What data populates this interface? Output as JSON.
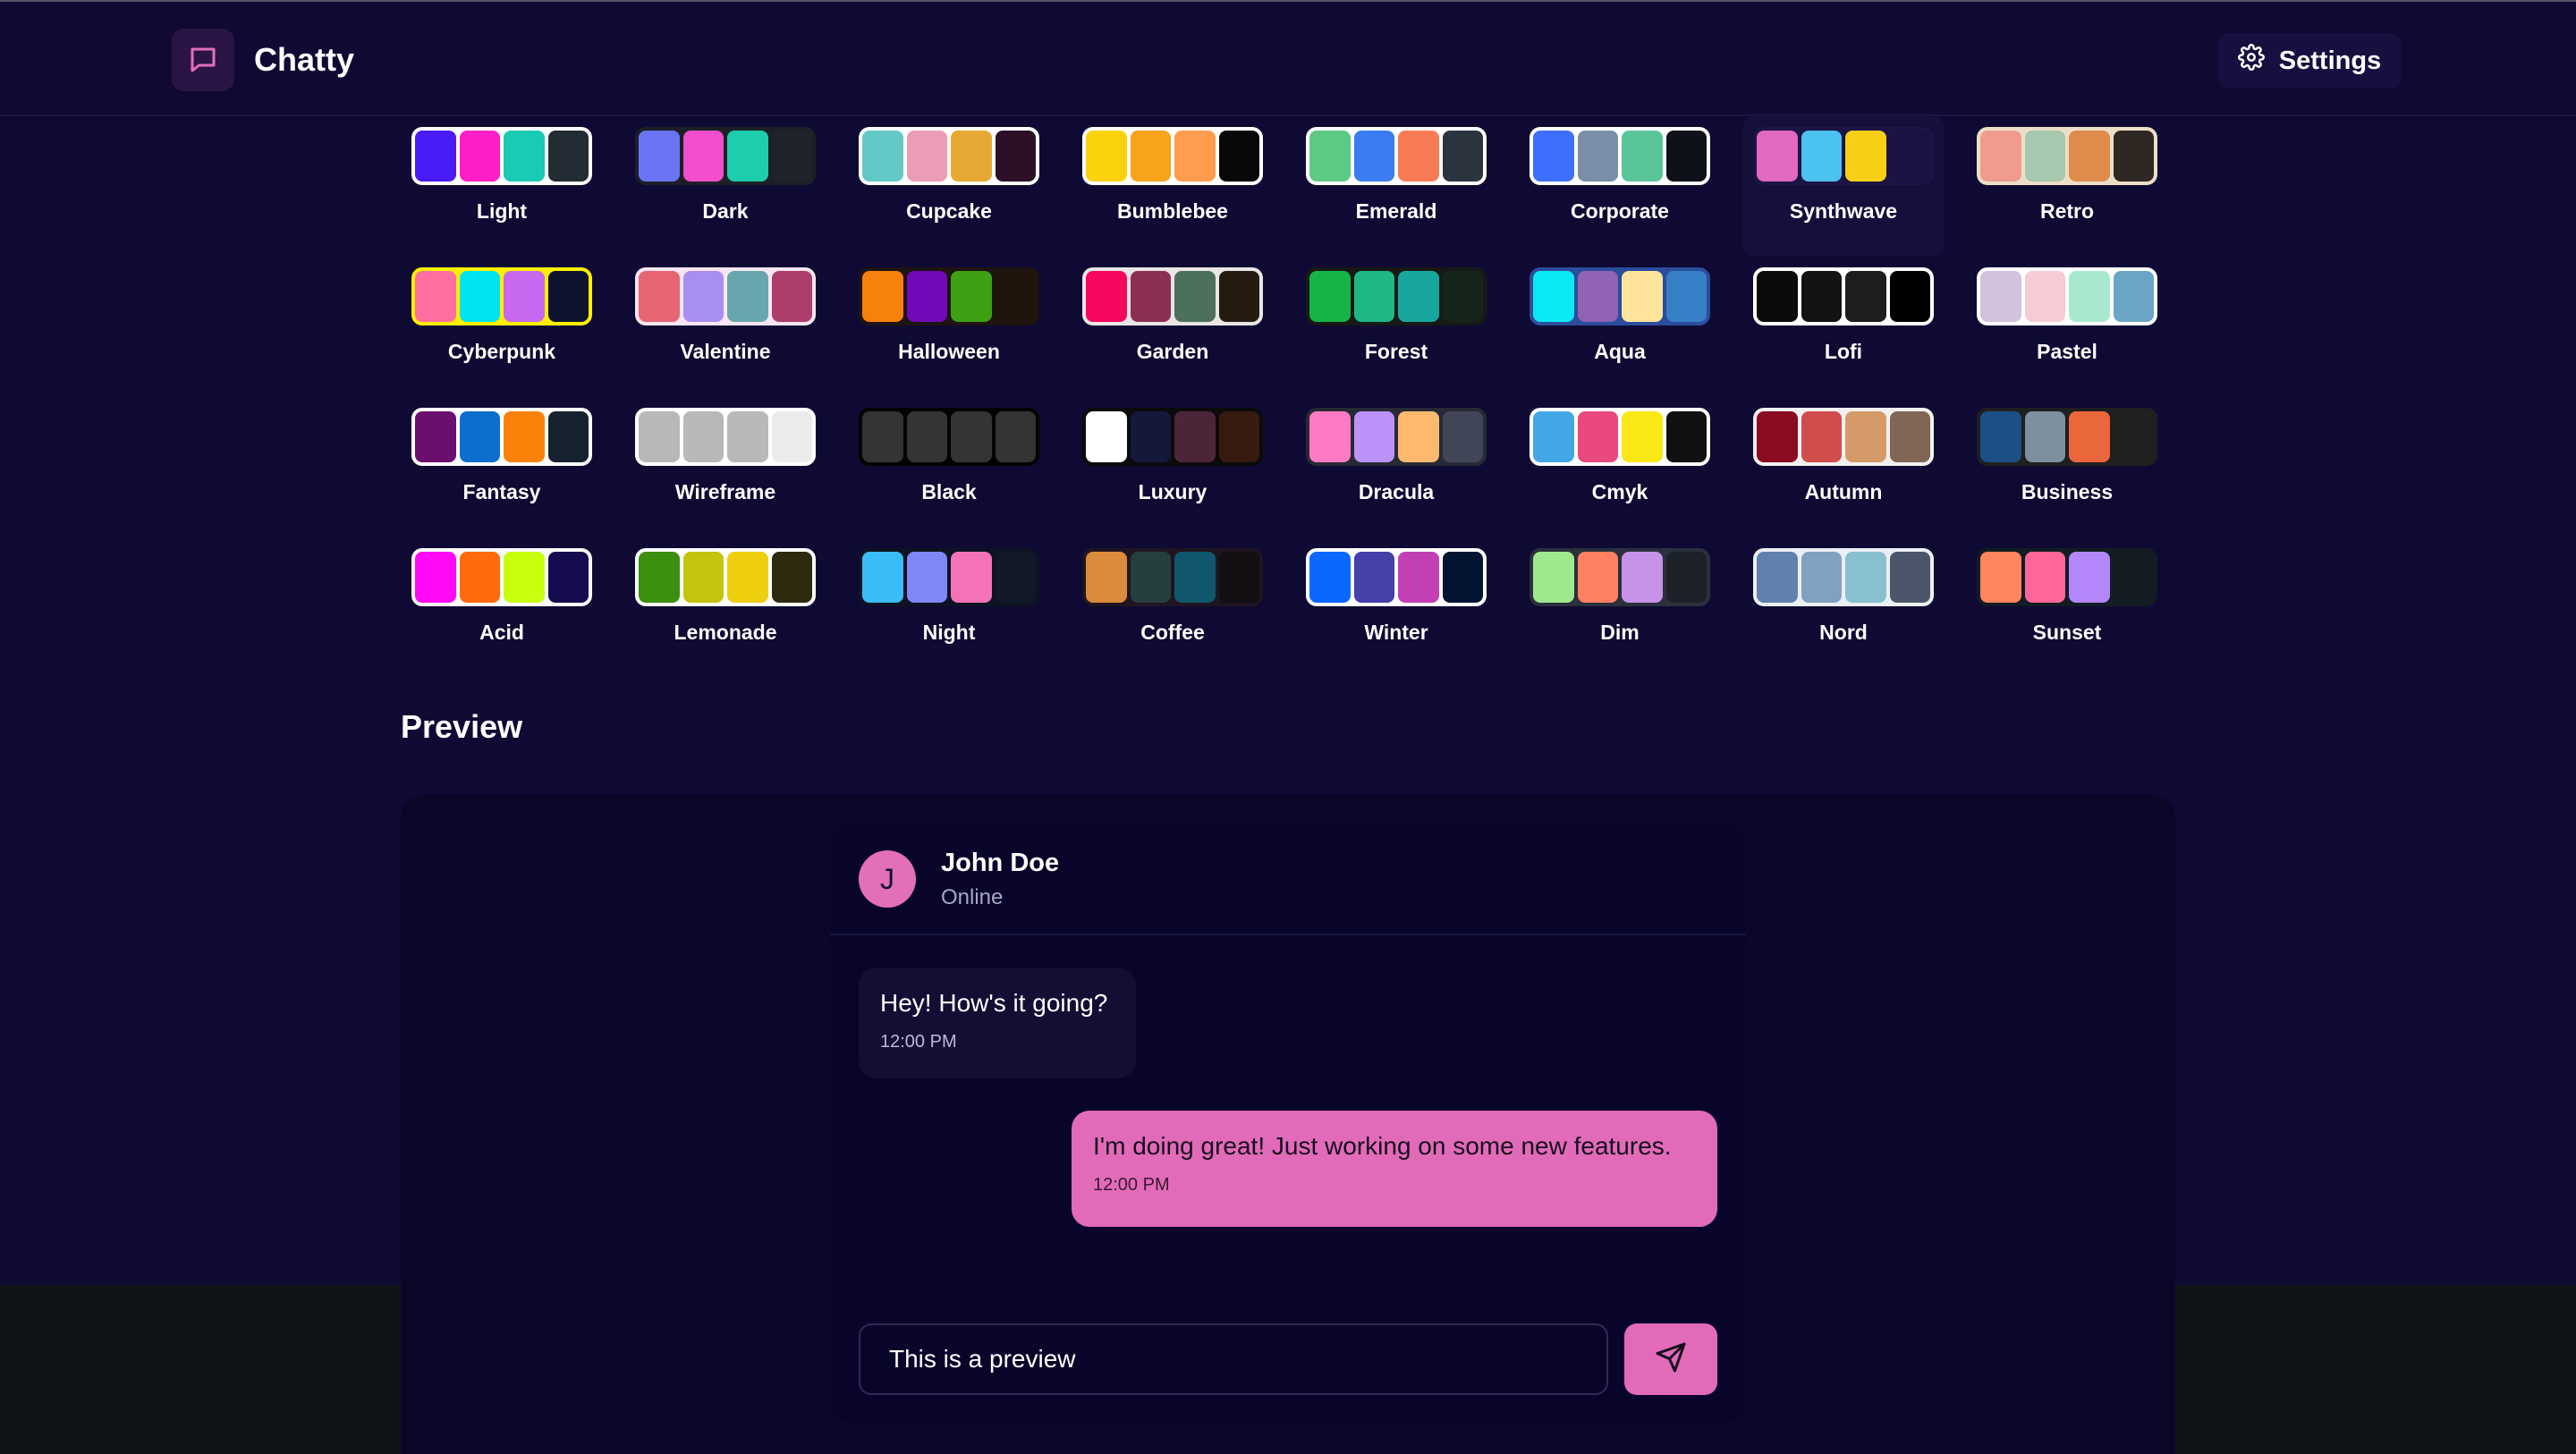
{
  "header": {
    "app_name": "Chatty",
    "settings_label": "Settings"
  },
  "themes": [
    {
      "name": "Light",
      "colors": [
        "#4a1cf5",
        "#ff1fc8",
        "#17cbb5",
        "#232c35"
      ],
      "frame": "#ffffff"
    },
    {
      "name": "Dark",
      "colors": [
        "#6b74f3",
        "#f24dcd",
        "#1ecdab",
        "#1f232a"
      ],
      "frame": "#1c2026"
    },
    {
      "name": "Cupcake",
      "colors": [
        "#63c9c7",
        "#ed9cb5",
        "#e7a933",
        "#2b1028"
      ],
      "frame": "#ffffff"
    },
    {
      "name": "Bumblebee",
      "colors": [
        "#fcd20c",
        "#f7a31b",
        "#ff9c4e",
        "#080808"
      ],
      "frame": "#ffffff"
    },
    {
      "name": "Emerald",
      "colors": [
        "#5ec984",
        "#3b7cf3",
        "#f97b56",
        "#2c3440"
      ],
      "frame": "#ffffff"
    },
    {
      "name": "Corporate",
      "colors": [
        "#3d6ffa",
        "#7a8ea8",
        "#5bc59a",
        "#0f111a"
      ],
      "frame": "#ffffff"
    },
    {
      "name": "Synthwave",
      "colors": [
        "#e268c2",
        "#4bc2ef",
        "#f7cf17",
        "#1b1244"
      ],
      "frame": "#1b1444"
    },
    {
      "name": "Retro",
      "colors": [
        "#ef9b8e",
        "#a6c8ae",
        "#df8b4c",
        "#2f2822"
      ],
      "frame": "#ebe0c7"
    },
    {
      "name": "Cyberpunk",
      "colors": [
        "#ff6fa0",
        "#00e3ef",
        "#c868f0",
        "#0e1430"
      ],
      "frame": "#fff000"
    },
    {
      "name": "Valentine",
      "colors": [
        "#e76573",
        "#a88ef0",
        "#67a6ad",
        "#ad3d6a"
      ],
      "frame": "#f8e6f2"
    },
    {
      "name": "Halloween",
      "colors": [
        "#f8800c",
        "#7209b8",
        "#3ea013",
        "#21140c"
      ],
      "frame": "#1e1410"
    },
    {
      "name": "Garden",
      "colors": [
        "#f7065f",
        "#8c2f55",
        "#4c7059",
        "#251b10"
      ],
      "frame": "#eae6e6"
    },
    {
      "name": "Forest",
      "colors": [
        "#16b448",
        "#1eb883",
        "#17a79e",
        "#16251c"
      ],
      "frame": "#161915"
    },
    {
      "name": "Aqua",
      "colors": [
        "#0be9f3",
        "#9063b5",
        "#ffe49c",
        "#3580c6"
      ],
      "frame": "#2c4d9c"
    },
    {
      "name": "Lofi",
      "colors": [
        "#0b0b0b",
        "#131313",
        "#1e1e1e",
        "#000000"
      ],
      "frame": "#ffffff"
    },
    {
      "name": "Pastel",
      "colors": [
        "#d3c1de",
        "#f6cbd3",
        "#a8e8cf",
        "#6ba5c6"
      ],
      "frame": "#ffffff"
    },
    {
      "name": "Fantasy",
      "colors": [
        "#6c0e6e",
        "#0a6fcd",
        "#fb820a",
        "#172230"
      ],
      "frame": "#ffffff"
    },
    {
      "name": "Wireframe",
      "colors": [
        "#b8b8b8",
        "#b8b8b8",
        "#b8b8b8",
        "#ebebeb"
      ],
      "frame": "#ffffff"
    },
    {
      "name": "Black",
      "colors": [
        "#343434",
        "#343434",
        "#343434",
        "#343434"
      ],
      "frame": "#030303"
    },
    {
      "name": "Luxury",
      "colors": [
        "#ffffff",
        "#14183a",
        "#4c2638",
        "#371a10"
      ],
      "frame": "#0b0b0b"
    },
    {
      "name": "Dracula",
      "colors": [
        "#ff7ac4",
        "#bb93f8",
        "#ffb96e",
        "#414558"
      ],
      "frame": "#272935"
    },
    {
      "name": "Cmyk",
      "colors": [
        "#43a7e7",
        "#e9497f",
        "#fbe917",
        "#111111"
      ],
      "frame": "#ffffff"
    },
    {
      "name": "Autumn",
      "colors": [
        "#8b0b21",
        "#d14d4c",
        "#d49b68",
        "#826655"
      ],
      "frame": "#f1f1f1"
    },
    {
      "name": "Business",
      "colors": [
        "#1c4f85",
        "#7c909f",
        "#e9673b",
        "#202020"
      ],
      "frame": "#1f1f20"
    },
    {
      "name": "Acid",
      "colors": [
        "#ff09f7",
        "#ff6a0c",
        "#c7ff0d",
        "#140c4e"
      ],
      "frame": "#fafafa"
    },
    {
      "name": "Lemonade",
      "colors": [
        "#3d8f10",
        "#c3c40c",
        "#eecf10",
        "#2d2a0f"
      ],
      "frame": "#ffffff"
    },
    {
      "name": "Night",
      "colors": [
        "#3abcf8",
        "#8186f6",
        "#f473b6",
        "#111827"
      ],
      "frame": "#0d1322"
    },
    {
      "name": "Coffee",
      "colors": [
        "#db8b3c",
        "#263e3f",
        "#10576d",
        "#120e12"
      ],
      "frame": "#1f1520"
    },
    {
      "name": "Winter",
      "colors": [
        "#0b68ff",
        "#4640aa",
        "#c240b4",
        "#021431"
      ],
      "frame": "#ffffff"
    },
    {
      "name": "Dim",
      "colors": [
        "#9fe88e",
        "#ff8063",
        "#c792e9",
        "#1c2129"
      ],
      "frame": "#2a303c"
    },
    {
      "name": "Nord",
      "colors": [
        "#5f81ac",
        "#81a1c1",
        "#88c0d0",
        "#4c566a"
      ],
      "frame": "#eceff4"
    },
    {
      "name": "Sunset",
      "colors": [
        "#ff855f",
        "#ff6699",
        "#b387fa",
        "#121c22"
      ],
      "frame": "#121c22"
    }
  ],
  "active_theme": "Synthwave",
  "preview": {
    "title": "Preview",
    "contact": {
      "initial": "J",
      "name": "John Doe",
      "status": "Online"
    },
    "messages": [
      {
        "text": "Hey! How's it going?",
        "time": "12:00 PM",
        "direction": "incoming"
      },
      {
        "text": "I'm doing great! Just working on some new features.",
        "time": "12:00 PM",
        "direction": "outgoing"
      }
    ],
    "input_value": "This is a preview",
    "send_icon": "send-icon"
  },
  "colors": {
    "background": "#0f0a33",
    "accent": "#e26bb9",
    "footer": "#101419"
  }
}
